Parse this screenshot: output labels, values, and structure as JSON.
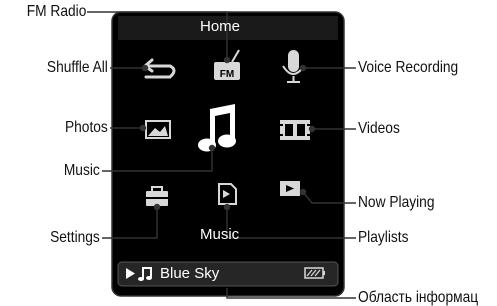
{
  "screen": {
    "title": "Home",
    "highlighted_label": "Music",
    "now_playing": {
      "icons": [
        "play-icon",
        "music-note-icon"
      ],
      "track": "Blue Sky",
      "battery": "battery-icon"
    }
  },
  "callouts": {
    "fm_radio": "FM Radio",
    "shuffle_all": "Shuffle All",
    "photos": "Photos",
    "music": "Music",
    "settings": "Settings",
    "voice_recording": "Voice Recording",
    "videos": "Videos",
    "now_playing": "Now Playing",
    "playlists": "Playlists",
    "info_area": "Область інформац"
  },
  "colors": {
    "screen_bg": "#000000",
    "screen_border": "#333333",
    "icon_gray": "#d8d8d8",
    "leader_line": "#333333",
    "status_bar": "#555555"
  },
  "icons": [
    "fm-radio-icon",
    "shuffle-icon",
    "microphone-icon",
    "photo-icon",
    "music-note-icon",
    "film-icon",
    "toolbox-icon",
    "playlist-icon",
    "now-playing-icon"
  ]
}
